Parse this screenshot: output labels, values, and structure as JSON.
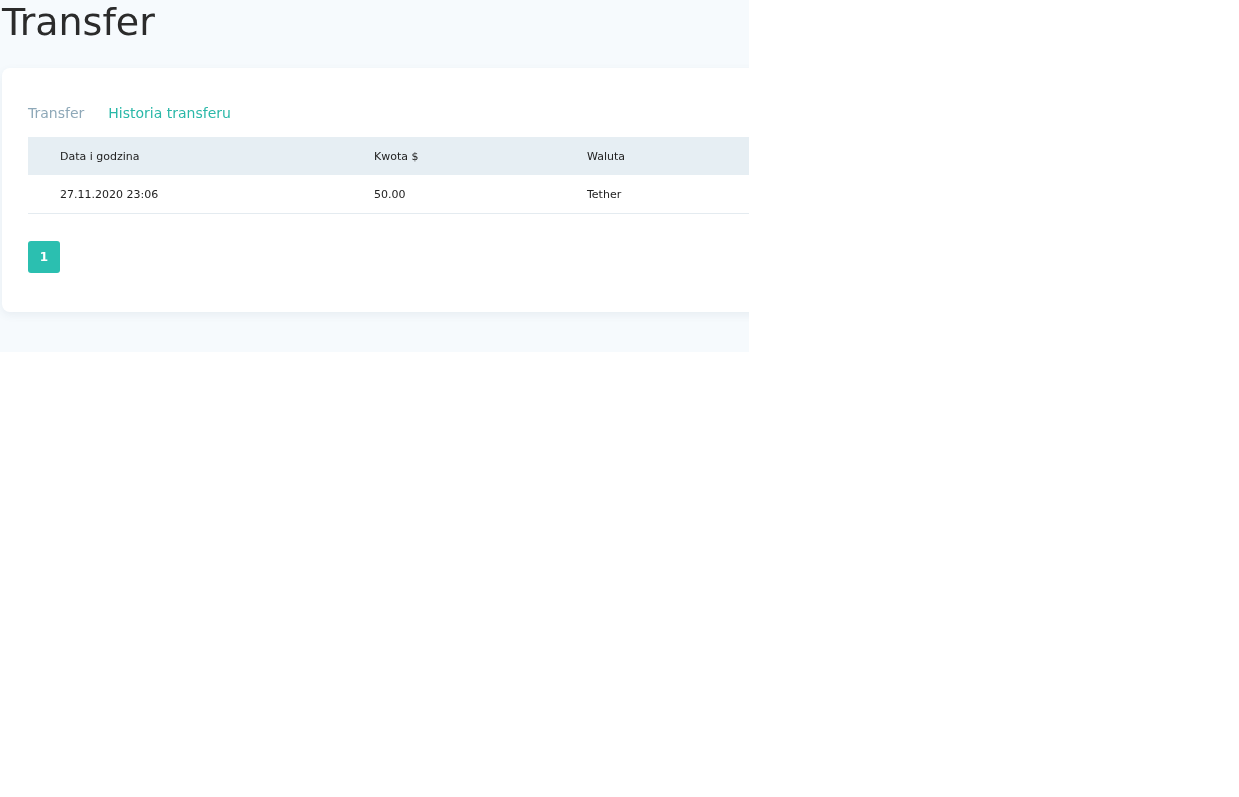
{
  "page_title": "Transfer",
  "tabs": [
    {
      "label": "Transfer",
      "selected": false
    },
    {
      "label": "Historia transferu",
      "selected": true
    }
  ],
  "table": {
    "columns": [
      "Data i godzina",
      "Kwota $",
      "Waluta"
    ],
    "rows": [
      [
        "27.11.2020 23:06",
        "50.00",
        "Tether"
      ]
    ]
  },
  "pagination": [
    {
      "label": "1",
      "selected": true
    }
  ]
}
